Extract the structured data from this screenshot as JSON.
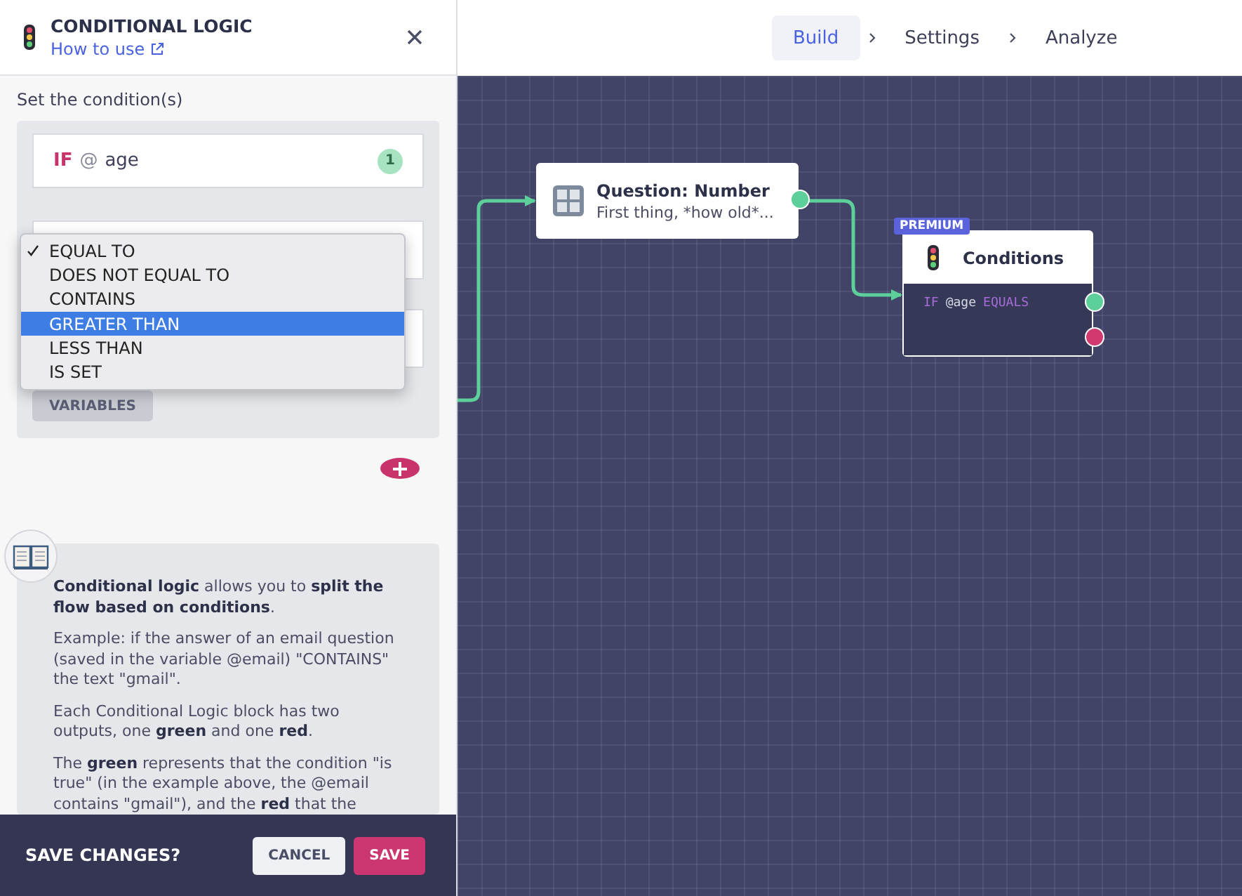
{
  "panel": {
    "title": "CONDITIONAL LOGIC",
    "help_link": "How to use",
    "section_label": "Set the condition(s)",
    "condition": {
      "keyword": "IF",
      "at": "@",
      "variable": "age",
      "badge": "1"
    },
    "operator_menu": [
      {
        "label": "EQUAL TO",
        "checked": true,
        "highlighted": false
      },
      {
        "label": "DOES NOT EQUAL TO",
        "checked": false,
        "highlighted": false
      },
      {
        "label": "CONTAINS",
        "checked": false,
        "highlighted": false
      },
      {
        "label": "GREATER THAN",
        "checked": false,
        "highlighted": true
      },
      {
        "label": "LESS THAN",
        "checked": false,
        "highlighted": false
      },
      {
        "label": "IS SET",
        "checked": false,
        "highlighted": false
      }
    ],
    "variables_button": "VARIABLES",
    "help": [
      "**Conditional logic** allows you to **split the flow based on conditions**.",
      "Example: if the answer of an email question (saved in the variable @email) \"CONTAINS\" the text \"gmail\".",
      "Each Conditional Logic block has two outputs, one **green** and one **red**.",
      "The **green** represents that the condition \"is true\" (in the example above, the @email contains \"gmail\"), and the **red** that the"
    ],
    "footer": {
      "prompt": "SAVE CHANGES?",
      "cancel": "CANCEL",
      "save": "SAVE"
    }
  },
  "nav": [
    {
      "label": "Build",
      "selected": true
    },
    {
      "label": "Settings",
      "selected": false
    },
    {
      "label": "Analyze",
      "selected": false
    }
  ],
  "canvas": {
    "question_node": {
      "title": "Question: Number",
      "subtitle": "First thing, *how old*..."
    },
    "conditions_node": {
      "badge": "PREMIUM",
      "title": "Conditions",
      "keyword": "IF",
      "variable": "@age",
      "operator": "EQUALS",
      "outputs": [
        {
          "color": "#5ccf9a"
        },
        {
          "color": "#d1396f"
        }
      ]
    }
  }
}
